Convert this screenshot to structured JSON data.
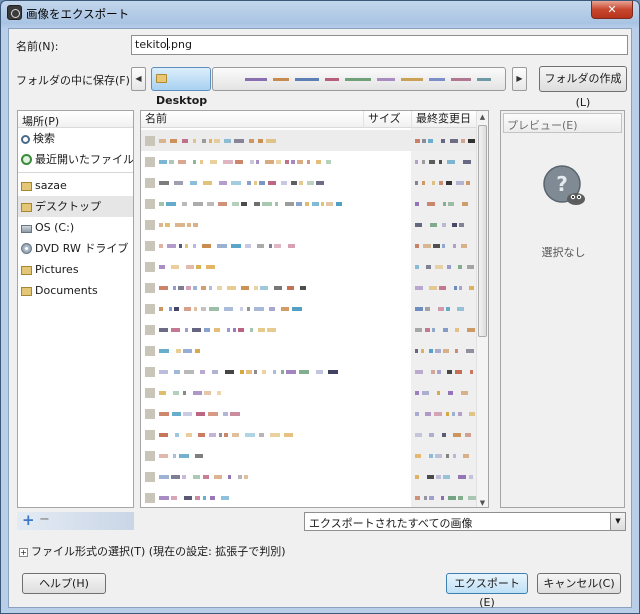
{
  "window": {
    "title": "画像をエクスポート",
    "close": "✕"
  },
  "name_field": {
    "label": "名前(N):",
    "value_before_caret": "tekito",
    "value_after_caret": ".png"
  },
  "save_in": {
    "label": "フォルダの中に保存(F):",
    "back": "◀",
    "current": "Desktop",
    "forward": "▶",
    "create_folder": "フォルダの作成(L)"
  },
  "places": {
    "header": "場所(P)",
    "items": [
      {
        "label": "検索",
        "icon": "search-icon"
      },
      {
        "label": "最近開いたファイル",
        "icon": "recent-icon"
      },
      {
        "label": "sazae",
        "icon": "folder-icon"
      },
      {
        "label": "デスクトップ",
        "icon": "folder-icon"
      },
      {
        "label": "OS (C:)",
        "icon": "drive-icon"
      },
      {
        "label": "DVD RW ドライブ …",
        "icon": "dvd-icon"
      },
      {
        "label": "Pictures",
        "icon": "folder-icon"
      },
      {
        "label": "Documents",
        "icon": "folder-icon"
      }
    ]
  },
  "files": {
    "col_name": "名前",
    "col_size": "サイズ",
    "col_modified": "最終変更日",
    "sort_indicator": "▼",
    "scroll_up": "▲",
    "scroll_down": "▼"
  },
  "preview": {
    "header": "プレビュー(E)",
    "empty_text": "選択なし"
  },
  "places_controls": {
    "add": "+",
    "remove": "−"
  },
  "filter": {
    "value": "エクスポートされたすべての画像",
    "drop": "▼"
  },
  "file_type": {
    "expander": "+",
    "label": "ファイル形式の選択(T) (現在の設定: 拡張子で判別)"
  },
  "buttons": {
    "help": "ヘルプ(H)",
    "export": "エクスポート(E)",
    "cancel": "キャンセル(C)"
  }
}
